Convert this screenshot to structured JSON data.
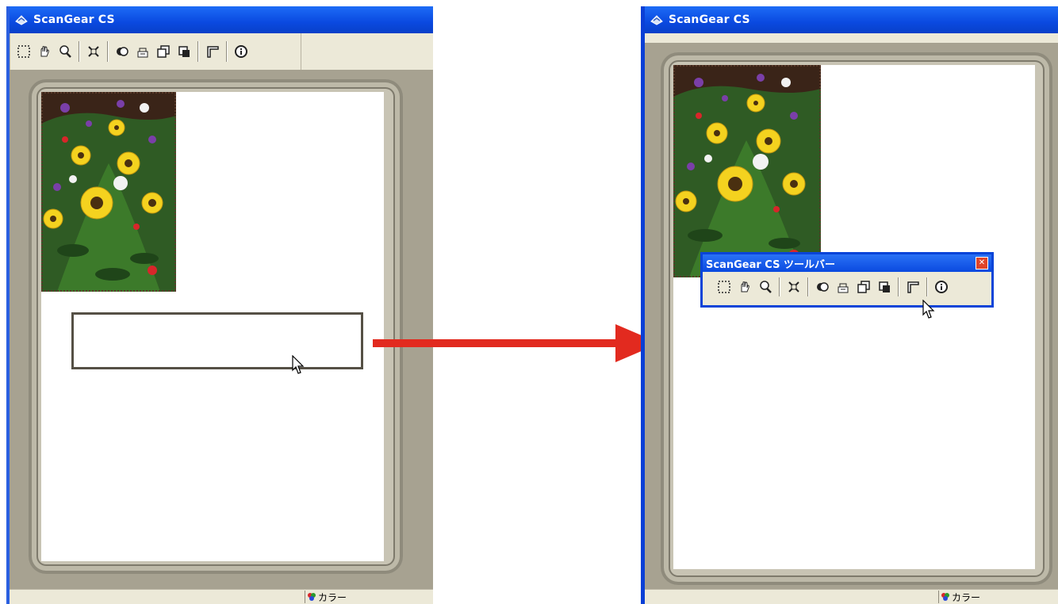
{
  "left_window": {
    "title": "ScanGear CS",
    "status_color_label": "カラー"
  },
  "right_window": {
    "title": "ScanGear CS",
    "status_color_label": "カラー",
    "floating_toolbar": {
      "title": "ScanGear CS ツールバー"
    }
  },
  "toolbar_icons": [
    "marquee-select-icon",
    "hand-icon",
    "zoom-icon",
    "auto-crop-icon",
    "color-icon",
    "gray-icon",
    "duplicate-icon",
    "copy-icon",
    "corner-icon",
    "info-icon"
  ],
  "colors": {
    "xp_title_blue": "#0a49e0",
    "window_face": "#ece9d8",
    "canvas_gray": "#a7a291",
    "arrow_red": "#e22a1f"
  }
}
